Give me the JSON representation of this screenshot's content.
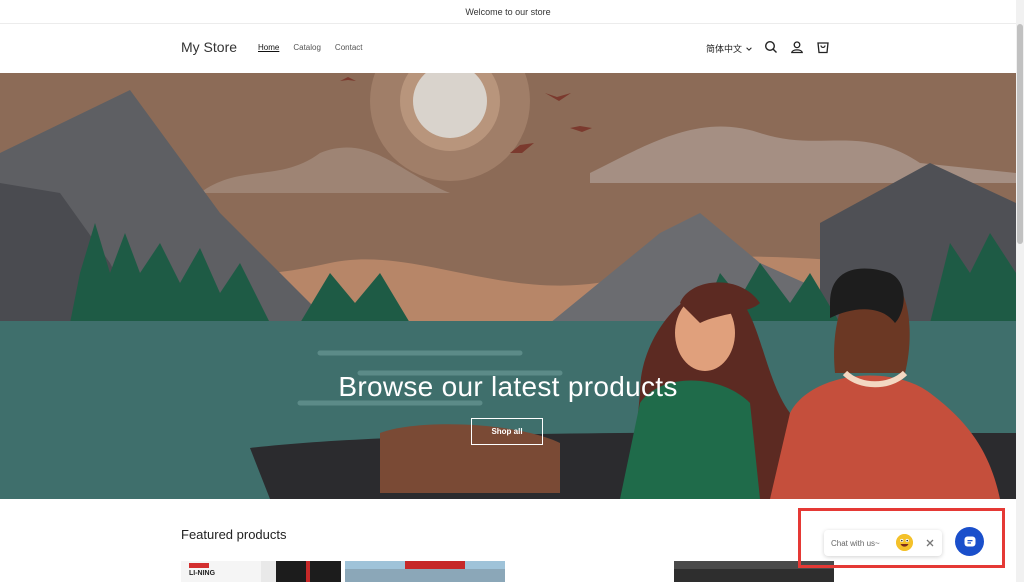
{
  "announcement": "Welcome to our store",
  "header": {
    "logo": "My Store",
    "nav": [
      "Home",
      "Catalog",
      "Contact"
    ],
    "language": "简体中文"
  },
  "hero": {
    "title": "Browse our latest products",
    "button": "Shop all"
  },
  "featured": {
    "title": "Featured products",
    "product_badge_text": "LI-NING"
  },
  "chat": {
    "label": "Chat with us~"
  },
  "icons": {
    "search": "search-icon",
    "account": "account-icon",
    "cart": "cart-icon",
    "close": "close-icon",
    "chat": "chat-icon"
  },
  "colors": {
    "highlight": "#e53935",
    "chat_button": "#1a4fcb"
  }
}
